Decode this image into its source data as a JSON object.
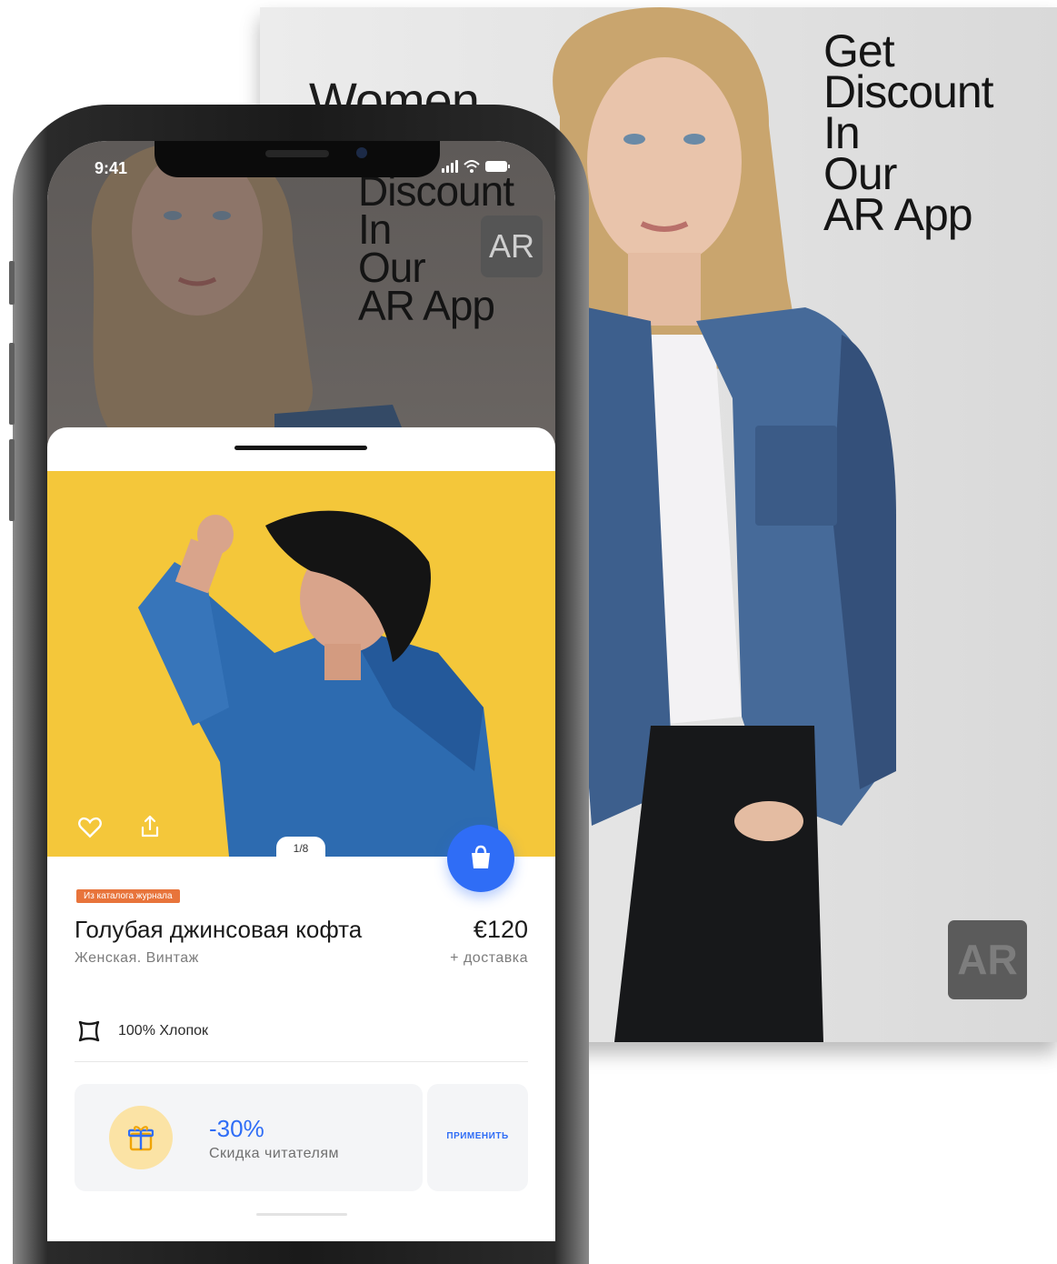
{
  "magazine": {
    "title": "Women",
    "headline": [
      "Get",
      "Discount",
      "In",
      "Our",
      "AR App"
    ],
    "ar_badge": "AR"
  },
  "phone": {
    "status": {
      "time": "9:41"
    },
    "ar_headline": [
      "Discount",
      "In",
      "Our",
      "AR App"
    ],
    "ar_badge": "AR",
    "product": {
      "image_counter": "1/8",
      "tag": "Из каталога журнала",
      "title": "Голубая джинсовая кофта",
      "subtitle": "Женская. Винтаж",
      "price": "€120",
      "delivery": "+ доставка",
      "material": "100% Хлопок"
    },
    "promo": {
      "value": "-30%",
      "text": "Скидка читателям",
      "apply_label": "ПРИМЕНИТЬ"
    }
  },
  "icons": [
    "heart-icon",
    "share-icon",
    "shopping-bag-icon",
    "fabric-icon",
    "gift-icon",
    "signal-icon",
    "wifi-icon",
    "battery-icon"
  ],
  "colors": {
    "accent": "#2f6df6",
    "tag": "#e8743b",
    "photo_bg": "#f4c73a",
    "gift_bg": "#fbe3a5"
  }
}
